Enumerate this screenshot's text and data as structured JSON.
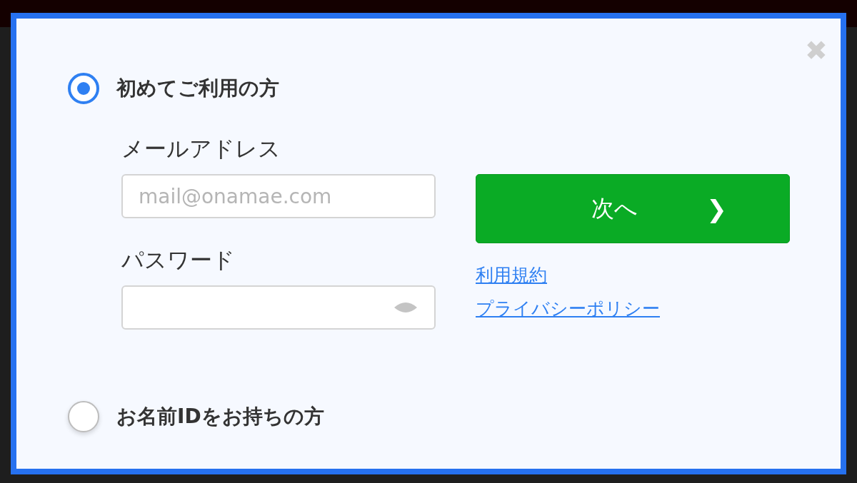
{
  "dialog": {
    "close": "✖"
  },
  "options": [
    {
      "label": "初めてご利用の方",
      "selected": true
    },
    {
      "label": "お名前IDをお持ちの方",
      "selected": false
    }
  ],
  "form": {
    "email": {
      "label": "メールアドレス",
      "placeholder": "mail@onamae.com"
    },
    "password": {
      "label": "パスワード"
    },
    "next_button": {
      "label": "次へ",
      "arrow": "❯"
    },
    "links": [
      "利用規約",
      "プライバシーポリシー"
    ]
  }
}
